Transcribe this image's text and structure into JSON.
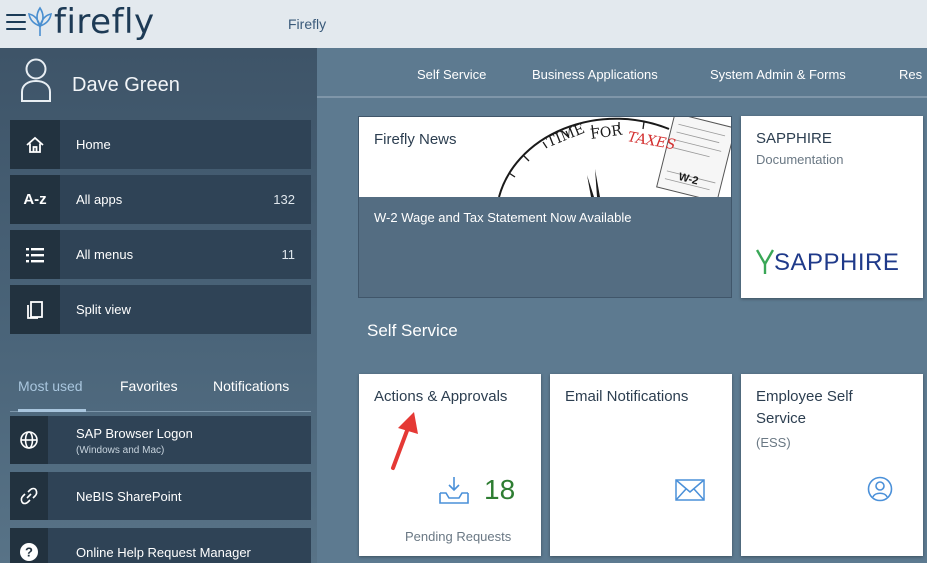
{
  "topbar": {
    "brand": "firefly",
    "app_title": "Firefly"
  },
  "profile": {
    "name": "Dave Green"
  },
  "sidebar": {
    "items": [
      {
        "label": "Home",
        "icon": "home-icon"
      },
      {
        "label": "All apps",
        "count": "132",
        "icon_text": "A-z"
      },
      {
        "label": "All menus",
        "count": "11",
        "icon": "list-icon"
      },
      {
        "label": "Split view",
        "icon": "split-view-icon"
      }
    ],
    "tabs": [
      "Most used",
      "Favorites",
      "Notifications"
    ],
    "list": [
      {
        "title": "SAP Browser Logon",
        "sub": "(Windows and Mac)",
        "icon": "globe-icon"
      },
      {
        "title": "NeBIS SharePoint",
        "icon": "link-icon"
      },
      {
        "title": "Online Help Request Manager",
        "icon": "help-icon"
      }
    ]
  },
  "nav": [
    "Self Service",
    "Business Applications",
    "System Admin & Forms",
    "Res"
  ],
  "news": {
    "title": "Firefly News",
    "image_text": "TIME FOR TAXES",
    "form_label": "W-2",
    "headline": "W-2 Wage and Tax Statement Now Available"
  },
  "sapphire": {
    "title": "SAPPHIRE",
    "subtitle": "Documentation",
    "logo": "SAPPHIRE"
  },
  "section": "Self Service",
  "tiles": {
    "actions": {
      "title": "Actions & Approvals",
      "count": "18",
      "footer": "Pending Requests"
    },
    "email": {
      "title": "Email Notifications"
    },
    "ess": {
      "title_line1": "Employee Self",
      "title_line2": "Service",
      "subtitle": "(ESS)"
    }
  },
  "colors": {
    "accent_green": "#2e7d32",
    "annotation_arrow": "#e53935",
    "sidebar_item_bg": "#2f4356"
  }
}
